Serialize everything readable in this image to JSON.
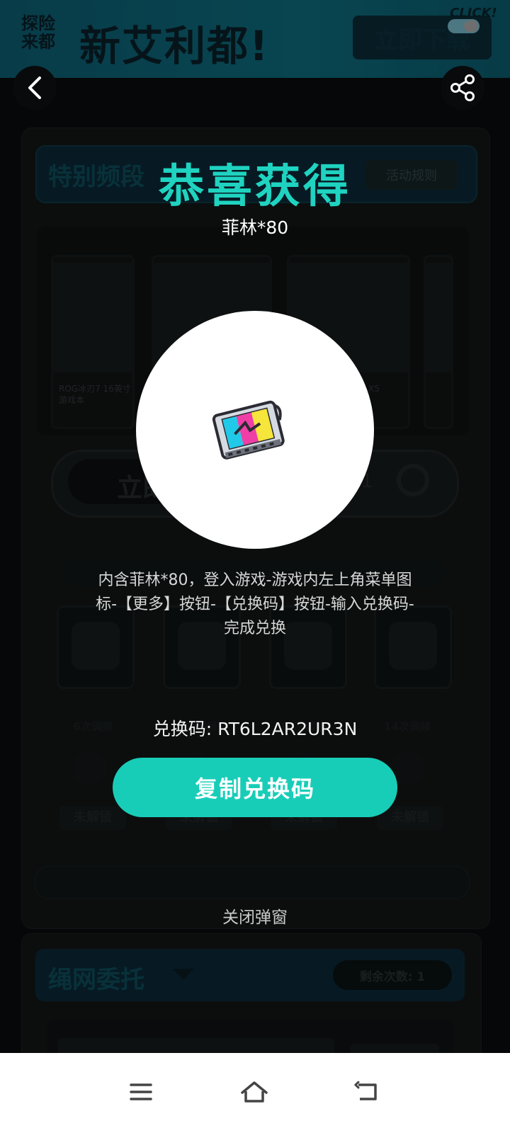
{
  "banner": {
    "small_text": "探险来都",
    "headline": "新艾利都!",
    "cta_label": "立即下载",
    "click_tag": "CLICK!"
  },
  "background": {
    "section_title": "特别频段",
    "rules_label": "活动规则",
    "products": [
      {
        "label": "ROG冰刃7 16英寸 游戏本"
      },
      {
        "label": ""
      },
      {
        "label": "X5"
      },
      {
        "label": ""
      }
    ],
    "draw_label": "立即",
    "draw_count": "1",
    "tiers": [
      {
        "title": "6次调频",
        "status": "未解锁"
      },
      {
        "title": "8次调频",
        "status": "未解锁"
      },
      {
        "title": "10次调频",
        "status": "未解锁"
      },
      {
        "title": "14次调频",
        "status": "未解锁"
      }
    ],
    "card2_title": "绳网委托",
    "remain_label": "剩余次数: 1"
  },
  "modal": {
    "title": "恭喜获得",
    "subtitle": "菲林*80",
    "reward_icon": "film-reel-icon",
    "description": "内含菲林*80，登入游戏-游戏内左上角菜单图标-【更多】按钮-【兑换码】按钮-输入兑换码-完成兑换",
    "code_line": "兑换码: RT6L2AR2UR3N",
    "copy_label": "复制兑换码",
    "close_label": "关闭弹窗"
  },
  "colors": {
    "accent": "#18cdb8",
    "title": "#1fd3c0"
  }
}
